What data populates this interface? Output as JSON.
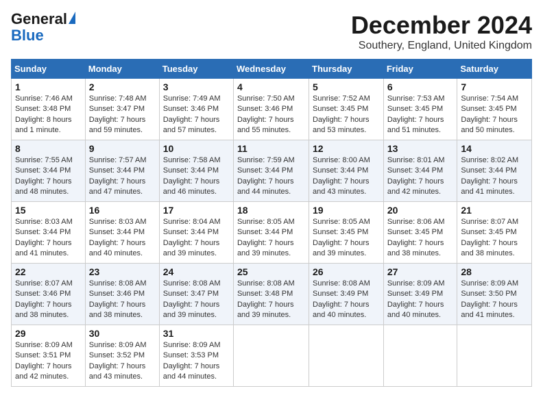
{
  "header": {
    "logo_line1": "General",
    "logo_line2": "Blue",
    "month_title": "December 2024",
    "location": "Southery, England, United Kingdom"
  },
  "days_of_week": [
    "Sunday",
    "Monday",
    "Tuesday",
    "Wednesday",
    "Thursday",
    "Friday",
    "Saturday"
  ],
  "weeks": [
    [
      {
        "day": "1",
        "sunrise": "7:46 AM",
        "sunset": "3:48 PM",
        "daylight": "8 hours and 1 minute."
      },
      {
        "day": "2",
        "sunrise": "7:48 AM",
        "sunset": "3:47 PM",
        "daylight": "7 hours and 59 minutes."
      },
      {
        "day": "3",
        "sunrise": "7:49 AM",
        "sunset": "3:46 PM",
        "daylight": "7 hours and 57 minutes."
      },
      {
        "day": "4",
        "sunrise": "7:50 AM",
        "sunset": "3:46 PM",
        "daylight": "7 hours and 55 minutes."
      },
      {
        "day": "5",
        "sunrise": "7:52 AM",
        "sunset": "3:45 PM",
        "daylight": "7 hours and 53 minutes."
      },
      {
        "day": "6",
        "sunrise": "7:53 AM",
        "sunset": "3:45 PM",
        "daylight": "7 hours and 51 minutes."
      },
      {
        "day": "7",
        "sunrise": "7:54 AM",
        "sunset": "3:45 PM",
        "daylight": "7 hours and 50 minutes."
      }
    ],
    [
      {
        "day": "8",
        "sunrise": "7:55 AM",
        "sunset": "3:44 PM",
        "daylight": "7 hours and 48 minutes."
      },
      {
        "day": "9",
        "sunrise": "7:57 AM",
        "sunset": "3:44 PM",
        "daylight": "7 hours and 47 minutes."
      },
      {
        "day": "10",
        "sunrise": "7:58 AM",
        "sunset": "3:44 PM",
        "daylight": "7 hours and 46 minutes."
      },
      {
        "day": "11",
        "sunrise": "7:59 AM",
        "sunset": "3:44 PM",
        "daylight": "7 hours and 44 minutes."
      },
      {
        "day": "12",
        "sunrise": "8:00 AM",
        "sunset": "3:44 PM",
        "daylight": "7 hours and 43 minutes."
      },
      {
        "day": "13",
        "sunrise": "8:01 AM",
        "sunset": "3:44 PM",
        "daylight": "7 hours and 42 minutes."
      },
      {
        "day": "14",
        "sunrise": "8:02 AM",
        "sunset": "3:44 PM",
        "daylight": "7 hours and 41 minutes."
      }
    ],
    [
      {
        "day": "15",
        "sunrise": "8:03 AM",
        "sunset": "3:44 PM",
        "daylight": "7 hours and 41 minutes."
      },
      {
        "day": "16",
        "sunrise": "8:03 AM",
        "sunset": "3:44 PM",
        "daylight": "7 hours and 40 minutes."
      },
      {
        "day": "17",
        "sunrise": "8:04 AM",
        "sunset": "3:44 PM",
        "daylight": "7 hours and 39 minutes."
      },
      {
        "day": "18",
        "sunrise": "8:05 AM",
        "sunset": "3:44 PM",
        "daylight": "7 hours and 39 minutes."
      },
      {
        "day": "19",
        "sunrise": "8:05 AM",
        "sunset": "3:45 PM",
        "daylight": "7 hours and 39 minutes."
      },
      {
        "day": "20",
        "sunrise": "8:06 AM",
        "sunset": "3:45 PM",
        "daylight": "7 hours and 38 minutes."
      },
      {
        "day": "21",
        "sunrise": "8:07 AM",
        "sunset": "3:45 PM",
        "daylight": "7 hours and 38 minutes."
      }
    ],
    [
      {
        "day": "22",
        "sunrise": "8:07 AM",
        "sunset": "3:46 PM",
        "daylight": "7 hours and 38 minutes."
      },
      {
        "day": "23",
        "sunrise": "8:08 AM",
        "sunset": "3:46 PM",
        "daylight": "7 hours and 38 minutes."
      },
      {
        "day": "24",
        "sunrise": "8:08 AM",
        "sunset": "3:47 PM",
        "daylight": "7 hours and 39 minutes."
      },
      {
        "day": "25",
        "sunrise": "8:08 AM",
        "sunset": "3:48 PM",
        "daylight": "7 hours and 39 minutes."
      },
      {
        "day": "26",
        "sunrise": "8:08 AM",
        "sunset": "3:49 PM",
        "daylight": "7 hours and 40 minutes."
      },
      {
        "day": "27",
        "sunrise": "8:09 AM",
        "sunset": "3:49 PM",
        "daylight": "7 hours and 40 minutes."
      },
      {
        "day": "28",
        "sunrise": "8:09 AM",
        "sunset": "3:50 PM",
        "daylight": "7 hours and 41 minutes."
      }
    ],
    [
      {
        "day": "29",
        "sunrise": "8:09 AM",
        "sunset": "3:51 PM",
        "daylight": "7 hours and 42 minutes."
      },
      {
        "day": "30",
        "sunrise": "8:09 AM",
        "sunset": "3:52 PM",
        "daylight": "7 hours and 43 minutes."
      },
      {
        "day": "31",
        "sunrise": "8:09 AM",
        "sunset": "3:53 PM",
        "daylight": "7 hours and 44 minutes."
      },
      null,
      null,
      null,
      null
    ]
  ]
}
